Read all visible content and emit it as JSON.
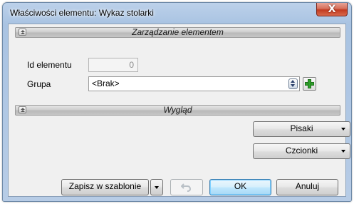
{
  "window": {
    "title": "Właściwości elementu: Wykaz stolarki",
    "close_glyph": "X"
  },
  "section_management": {
    "title": "Zarządzanie elementem",
    "id_label": "Id elementu",
    "id_value": "0",
    "group_label": "Grupa",
    "group_value": "<Brak>"
  },
  "section_appearance": {
    "title": "Wygląd",
    "pens_label": "Pisaki",
    "fonts_label": "Czcionki"
  },
  "footer": {
    "save_template_label": "Zapisz w szablonie",
    "ok_label": "OK",
    "cancel_label": "Anuluj"
  },
  "colors": {
    "accent_green": "#2ea12a",
    "close_red": "#c23b20",
    "ok_blue": "#3c7fb1"
  },
  "icons": [
    "close-icon",
    "collapse-icon",
    "spin-icon",
    "add-icon",
    "dropdown-arrow-icon",
    "undo-icon"
  ]
}
